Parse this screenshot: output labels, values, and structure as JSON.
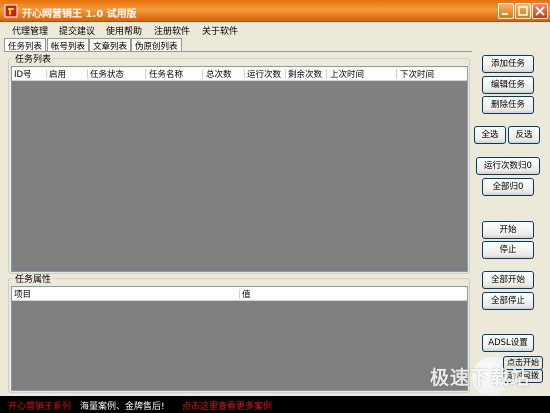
{
  "window": {
    "title": "开心网营销王 1.0 试用版"
  },
  "menu": [
    "代理管理",
    "提交建议",
    "使用帮助",
    "注册软件",
    "关于软件"
  ],
  "tabs": [
    "任务列表",
    "帐号列表",
    "文章列表",
    "伪原创列表"
  ],
  "task_group": {
    "legend": "任务列表",
    "columns": [
      "ID号",
      "启用",
      "任务状态",
      "任务名称",
      "总次数",
      "运行次数",
      "剩余次数",
      "上次时间",
      "下次时间"
    ]
  },
  "prop_group": {
    "legend": "任务属性",
    "columns": [
      "项目",
      "值"
    ]
  },
  "buttons": {
    "add_task": "添加任务",
    "edit_task": "编辑任务",
    "delete_task": "删除任务",
    "select_all": "全选",
    "invert": "反选",
    "reset_run_count": "运行次数归0",
    "reset_all": "全部归0",
    "start": "开始",
    "stop": "停止",
    "start_all": "全部开始",
    "stop_all": "全部停止",
    "adsl": "ADSL设置",
    "click_start": "点击开始",
    "timed_redial": "定时重拨"
  },
  "status": {
    "segment1": "开心营销王系列",
    "segment2": "海量案例、金牌售后!",
    "segment3": "点击这里查看更多案例"
  },
  "watermark": "极速下载站",
  "colors": {
    "title_orange": "#e8700c",
    "status_red": "#e01010",
    "list_gray": "#808080"
  }
}
